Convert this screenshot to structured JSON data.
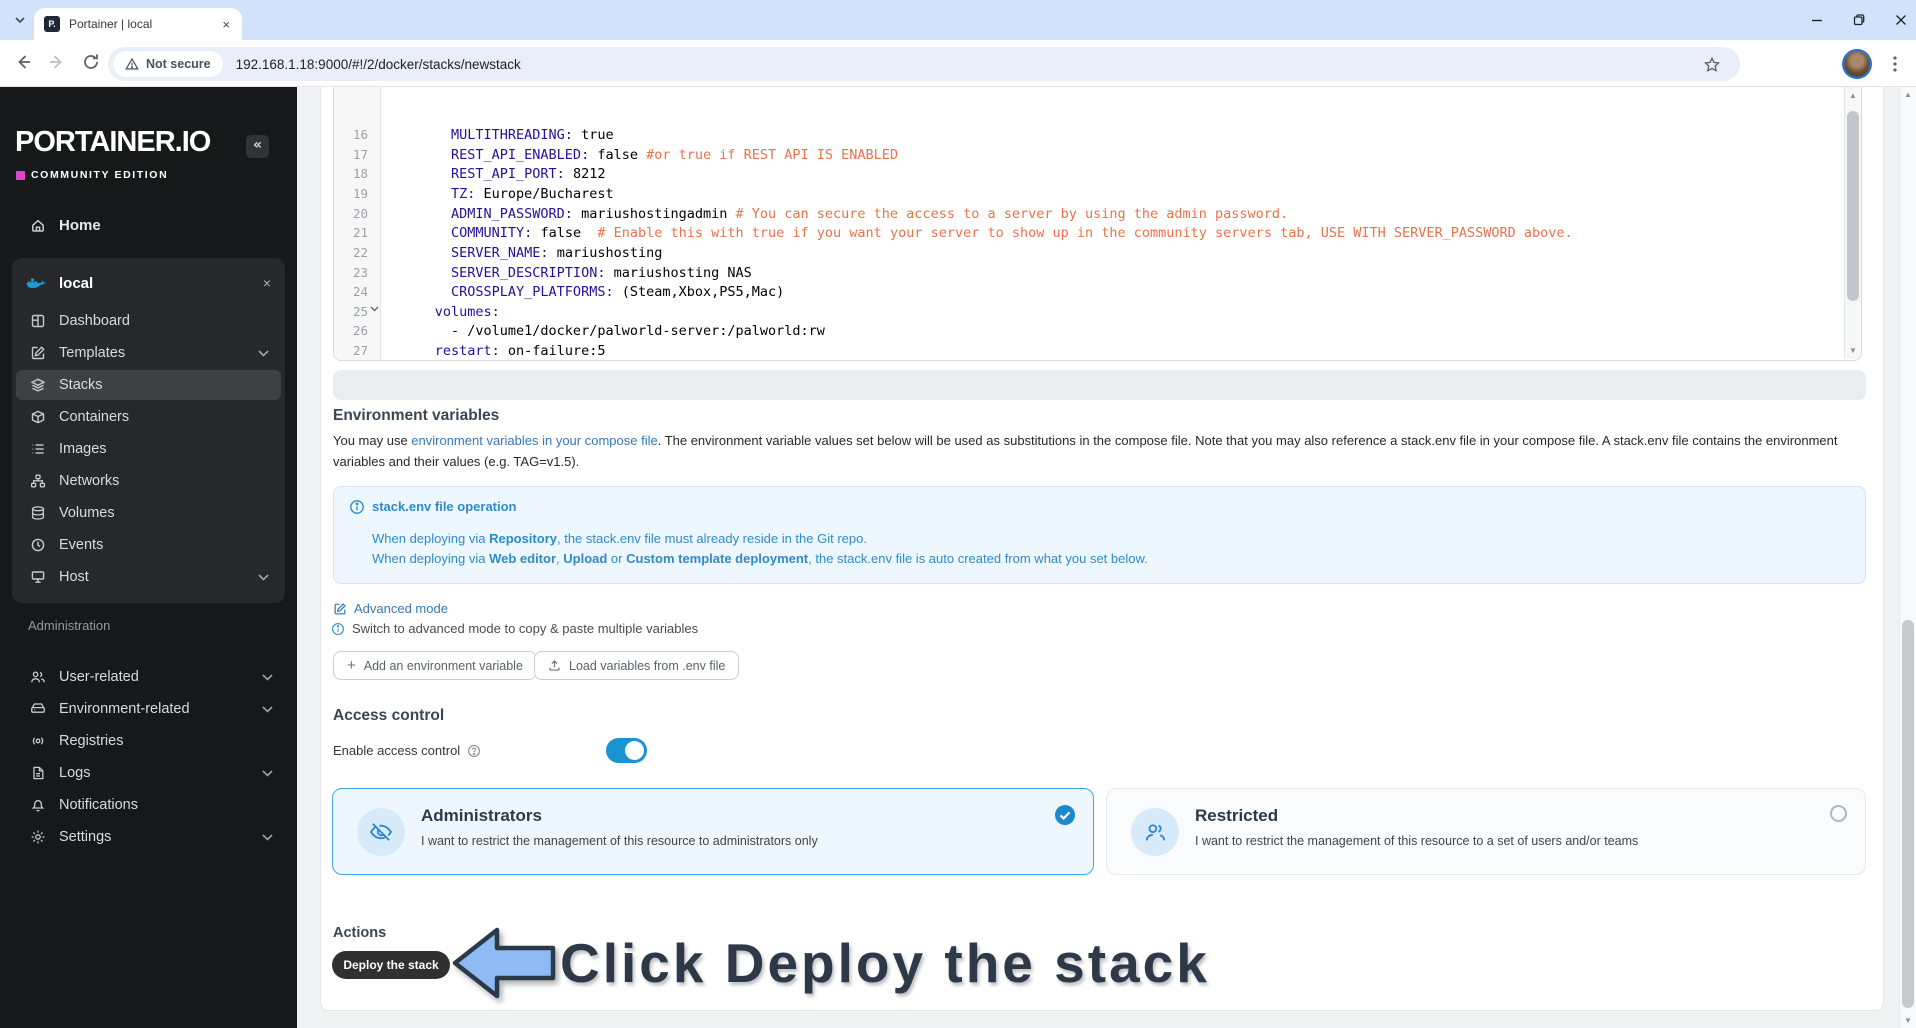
{
  "theme": {
    "accent": "#337ab7",
    "info": "#2e8bc9",
    "toggle_on": "#1a93d2",
    "check_blue": "#1d88cd",
    "brand_magenta": "#e043c9",
    "docker_blue": "#1d9bd7",
    "code_key": "#221199",
    "code_comment": "#e8734a",
    "annot_fill": "#8fbaf3",
    "annot_stroke": "#2b3a49",
    "annot_text": "#2d3946"
  },
  "browser": {
    "tab_title": "Portainer | local",
    "favicon_text": "P.",
    "security_label": "Not secure",
    "url": "192.168.1.18:9000/#!/2/docker/stacks/newstack"
  },
  "icons": {
    "collapse_glyph": "«",
    "env_close_glyph": "×",
    "tab_close_glyph": "×",
    "plus_glyph": "+",
    "tri_up": "▲",
    "tri_down": "▼"
  },
  "sidebar": {
    "logo_title": "PORTAINER.IO",
    "logo_subtitle": "COMMUNITY EDITION",
    "home_label": "Home",
    "environment": {
      "name": "local",
      "items": [
        {
          "label": "Dashboard"
        },
        {
          "label": "Templates"
        },
        {
          "label": "Stacks"
        },
        {
          "label": "Containers"
        },
        {
          "label": "Images"
        },
        {
          "label": "Networks"
        },
        {
          "label": "Volumes"
        },
        {
          "label": "Events"
        },
        {
          "label": "Host"
        }
      ]
    },
    "admin": {
      "label": "Administration",
      "items": [
        {
          "label": "User-related"
        },
        {
          "label": "Environment-related"
        },
        {
          "label": "Registries"
        },
        {
          "label": "Logs"
        },
        {
          "label": "Notifications"
        },
        {
          "label": "Settings"
        }
      ]
    }
  },
  "editor": {
    "lines": [
      {
        "no": "16",
        "key": "        MULTITHREADING:",
        "val": " true",
        "comment": ""
      },
      {
        "no": "17",
        "key": "        REST_API_ENABLED:",
        "val": " false ",
        "comment": "#or true if REST API IS ENABLED"
      },
      {
        "no": "18",
        "key": "        REST_API_PORT:",
        "val": " 8212",
        "comment": ""
      },
      {
        "no": "19",
        "key": "        TZ:",
        "val": " Europe/Bucharest",
        "comment": ""
      },
      {
        "no": "20",
        "key": "        ADMIN_PASSWORD:",
        "val": " mariushostingadmin ",
        "comment": "# You can secure the access to a server by using the admin password."
      },
      {
        "no": "21",
        "key": "        COMMUNITY:",
        "val": " false  ",
        "comment": "# Enable this with true if you want your server to show up in the community servers tab, USE WITH SERVER_PASSWORD above."
      },
      {
        "no": "22",
        "key": "        SERVER_NAME:",
        "val": " mariushosting",
        "comment": ""
      },
      {
        "no": "23",
        "key": "        SERVER_DESCRIPTION:",
        "val": " mariushosting NAS",
        "comment": ""
      },
      {
        "no": "24",
        "key": "        CROSSPLAY_PLATFORMS:",
        "val": " (Steam,Xbox,PS5,Mac)",
        "comment": ""
      },
      {
        "no": "25",
        "key": "      volumes:",
        "val": "",
        "comment": ""
      },
      {
        "no": "26",
        "key": "",
        "val": "        - /volume1/docker/palworld-server:/palworld:rw",
        "comment": ""
      },
      {
        "no": "27",
        "key": "      restart:",
        "val": " on-failure:5",
        "comment": ""
      }
    ]
  },
  "env_section": {
    "title": "Environment variables",
    "desc_pre": "You may use ",
    "desc_link": "environment variables in your compose file",
    "desc_post": ". The environment variable values set below will be used as substitutions in the compose file. Note that you may also reference a stack.env file in your compose file. A stack.env file contains the environment variables and their values (e.g. TAG=v1.5).",
    "infobox": {
      "title": "stack.env file operation",
      "l1_pre": "When deploying via ",
      "l1_b": "Repository",
      "l1_post": ", the stack.env file must already reside in the Git repo.",
      "l2_pre": "When deploying via ",
      "l2_b1": "Web editor",
      "l2_m1": ", ",
      "l2_b2": "Upload",
      "l2_m2": " or ",
      "l2_b3": "Custom template deployment",
      "l2_post": ", the stack.env file is auto created from what you set below."
    },
    "advanced_mode": "Advanced mode",
    "advanced_hint": "Switch to advanced mode to copy & paste multiple variables",
    "add_var_button": "Add an environment variable",
    "load_vars_button": "Load variables from .env file"
  },
  "access_control": {
    "title": "Access control",
    "toggle_label": "Enable access control",
    "options": [
      {
        "title": "Administrators",
        "desc": "I want to restrict the management of this resource to administrators only"
      },
      {
        "title": "Restricted",
        "desc": "I want to restrict the management of this resource to a set of users and/or teams"
      }
    ]
  },
  "actions": {
    "title": "Actions",
    "deploy_button": "Deploy the stack",
    "annotation": "Click Deploy the stack"
  }
}
